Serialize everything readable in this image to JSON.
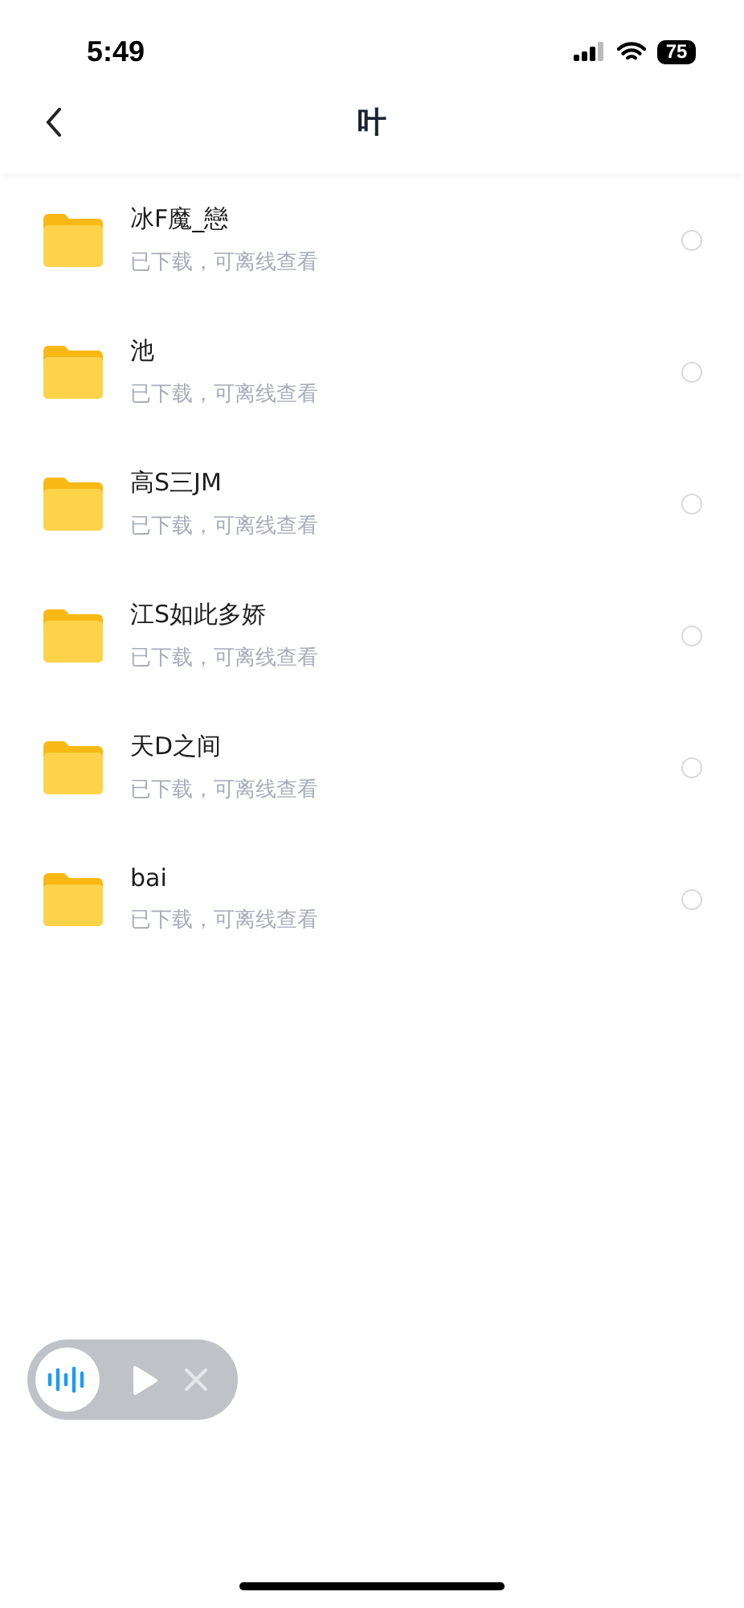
{
  "status_bar": {
    "time": "5:49",
    "battery": "75"
  },
  "nav": {
    "title": "叶"
  },
  "items": [
    {
      "name": "冰F魔_戀",
      "status": "已下载，可离线查看",
      "selected": false
    },
    {
      "name": "池",
      "status": "已下载，可离线查看",
      "selected": false
    },
    {
      "name": "高S三JM",
      "status": "已下载，可离线查看",
      "selected": false
    },
    {
      "name": "江S如此多娇",
      "status": "已下载，可离线查看",
      "selected": false
    },
    {
      "name": "天D之间",
      "status": "已下载，可离线查看",
      "selected": false
    },
    {
      "name": "bai",
      "status": "已下载，可离线查看",
      "selected": false
    }
  ]
}
